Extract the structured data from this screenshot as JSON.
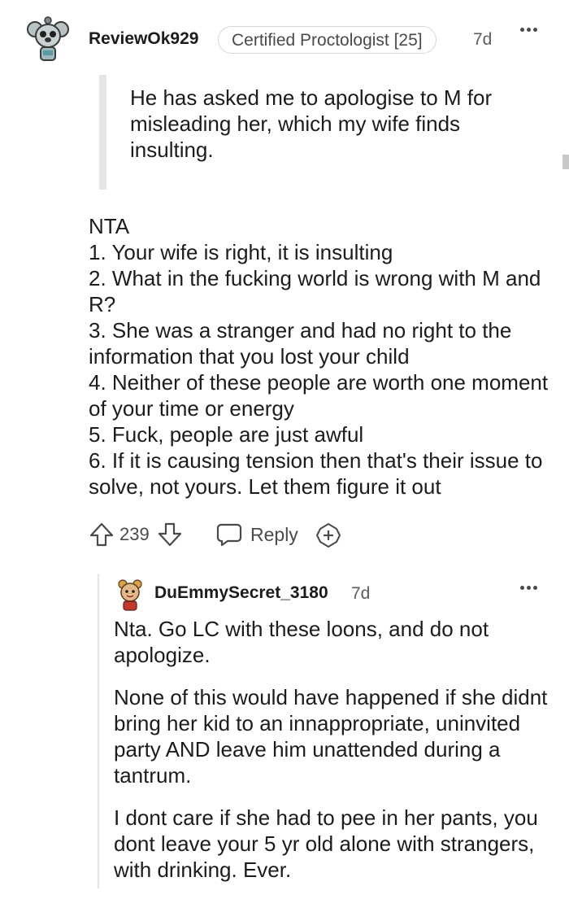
{
  "comment": {
    "username": "ReviewOk929",
    "flair": "Certified Proctologist [25]",
    "age": "7d",
    "quote": "He has asked me to apologise to M for misleading her, which my wife finds insulting.",
    "body": [
      "NTA",
      "1. Your wife is right, it is insulting",
      "2. What in the fucking world is wrong with M and R?",
      "3. She was a stranger and had no right to the information that you lost your child",
      "4. Neither of these people are worth one moment of your time or energy",
      "5. Fuck, people are just awful",
      "6. If it is causing tension then that's their issue to solve, not yours. Let them figure it out"
    ],
    "score": "239",
    "reply_label": "Reply"
  },
  "reply": {
    "username": "DuEmmySecret_3180",
    "age": "7d",
    "paragraphs": [
      "Nta. Go LC with these loons, and do not apologize.",
      "None of this would have happened if she didnt bring her kid to an innappropriate, uninvited party AND leave him unattended during a tantrum.",
      "I dont care if she had to pee in her pants, you dont leave your 5 yr old alone with strangers, with drinking. Ever."
    ]
  },
  "colors": {
    "text": "#1c1c1c",
    "muted": "#4a4a4a",
    "border": "#d7d7d7",
    "quote_bar": "#e5e5e5"
  },
  "icons": [
    "koala-avatar-icon",
    "more-options-icon",
    "upvote-icon",
    "downvote-icon",
    "reply-icon",
    "award-icon",
    "avatar-icon"
  ]
}
